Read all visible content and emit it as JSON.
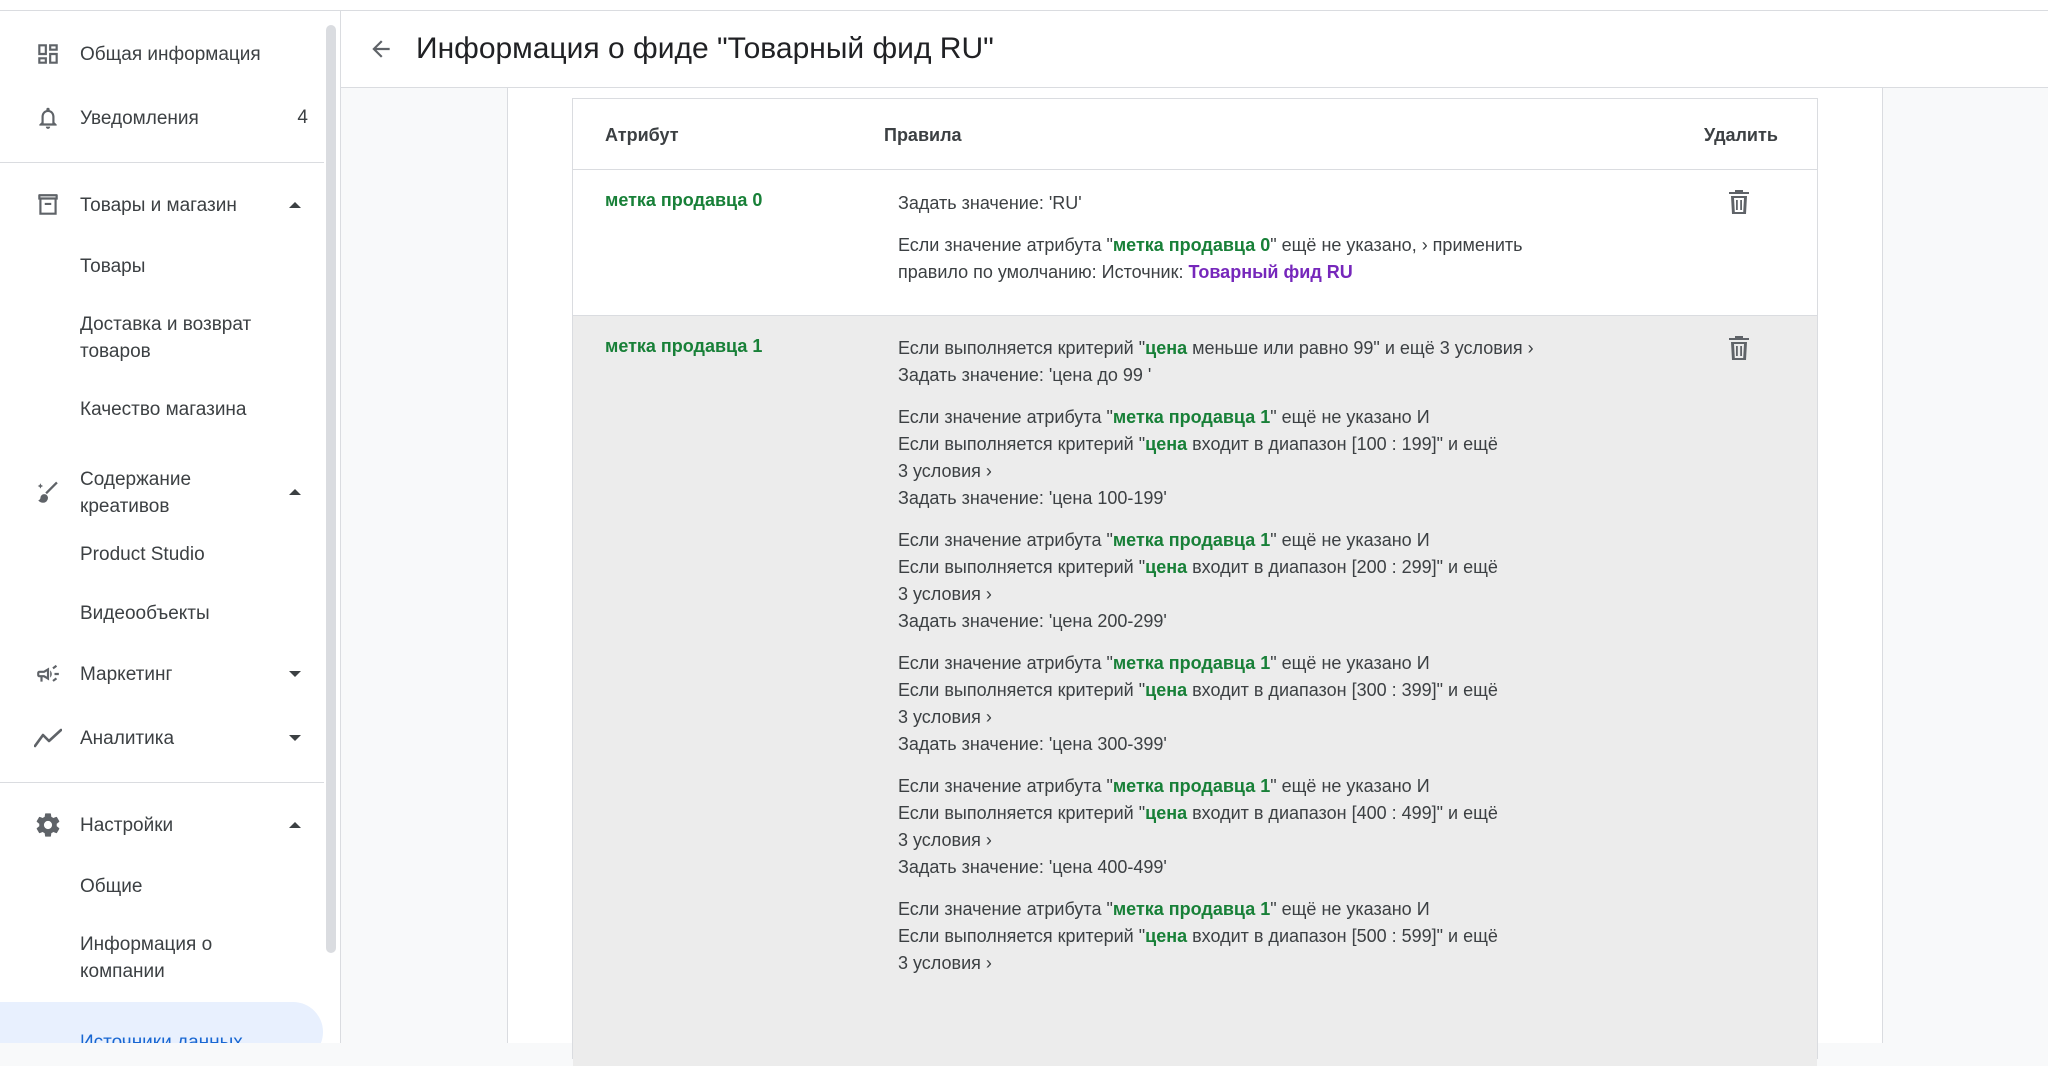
{
  "sidebar": {
    "overview": "Общая информация",
    "notifications": {
      "label": "Уведомления",
      "count": "4"
    },
    "products_section": "Товары и магазин",
    "products_items": [
      "Товары",
      "Доставка и возврат товаров",
      "Качество магазина"
    ],
    "creative_section": "Содержание креативов",
    "creative_items": [
      "Product Studio",
      "Видеообъекты"
    ],
    "marketing": "Маркетинг",
    "analytics": "Аналитика",
    "settings_section": "Настройки",
    "settings_items": [
      "Общие",
      "Информация о компании",
      "Источники данных"
    ]
  },
  "header": {
    "title": "Информация о фиде \"Товарный фид RU\""
  },
  "table": {
    "columns": {
      "attribute": "Атрибут",
      "rules": "Правила",
      "delete": "Удалить"
    },
    "rows": [
      {
        "attribute": "метка продавца 0",
        "r1": "Задать значение: 'RU'",
        "r2_pre": "Если значение атрибута \"",
        "r2_hl": "метка продавца 0",
        "r2_post": "\" ещё не указано, › применить",
        "r3_pre": "правило по умолчанию: Источник: ",
        "r3_link": "Товарный фид RU"
      },
      {
        "attribute": "метка продавца 1",
        "first": {
          "crit_pre": "Если выполняется критерий \"",
          "crit_hl": "цена",
          "crit_post": " меньше или равно 99\" и ещё 3 условия ›",
          "set": "Задать значение: 'цена до 99 '"
        },
        "groups": [
          {
            "l1_pre": "Если значение атрибута \"",
            "l1_hl": "метка продавца 1",
            "l1_post": "\" ещё не указано И",
            "l2_pre": "Если выполняется критерий \"",
            "l2_hl": "цена",
            "l2_post": " входит в диапазон [100 : 199]\" и ещё",
            "l3": "3 условия ›",
            "set": "Задать значение: 'цена 100-199'"
          },
          {
            "l1_pre": "Если значение атрибута \"",
            "l1_hl": "метка продавца 1",
            "l1_post": "\" ещё не указано И",
            "l2_pre": "Если выполняется критерий \"",
            "l2_hl": "цена",
            "l2_post": " входит в диапазон [200 : 299]\" и ещё",
            "l3": "3 условия ›",
            "set": "Задать значение: 'цена 200-299'"
          },
          {
            "l1_pre": "Если значение атрибута \"",
            "l1_hl": "метка продавца 1",
            "l1_post": "\" ещё не указано И",
            "l2_pre": "Если выполняется критерий \"",
            "l2_hl": "цена",
            "l2_post": " входит в диапазон [300 : 399]\" и ещё",
            "l3": "3 условия ›",
            "set": "Задать значение: 'цена 300-399'"
          },
          {
            "l1_pre": "Если значение атрибута \"",
            "l1_hl": "метка продавца 1",
            "l1_post": "\" ещё не указано И",
            "l2_pre": "Если выполняется критерий \"",
            "l2_hl": "цена",
            "l2_post": " входит в диапазон [400 : 499]\" и ещё",
            "l3": "3 условия ›",
            "set": "Задать значение: 'цена 400-499'"
          },
          {
            "l1_pre": "Если значение атрибута \"",
            "l1_hl": "метка продавца 1",
            "l1_post": "\" ещё не указано И",
            "l2_pre": "Если выполняется критерий \"",
            "l2_hl": "цена",
            "l2_post": " входит в диапазон [500 : 599]\" и ещё",
            "l3": "3 условия ›"
          }
        ]
      }
    ]
  },
  "colors": {
    "accent_green": "#188038",
    "link_purple": "#7627bb",
    "active_blue": "#1967d2"
  }
}
